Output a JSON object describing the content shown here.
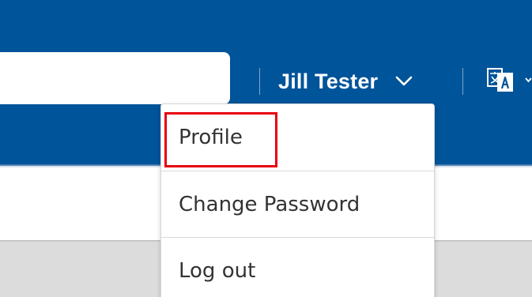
{
  "header": {
    "search": {
      "value": "",
      "placeholder": ""
    },
    "user": {
      "name": "Jill Tester",
      "icon": "chevron-down-icon"
    },
    "language": {
      "icon": "translate-icon"
    }
  },
  "user_dropdown": {
    "items": [
      {
        "label": "Profile",
        "highlighted": true
      },
      {
        "label": "Change Password",
        "highlighted": false
      },
      {
        "label": "Log out",
        "highlighted": false
      }
    ]
  },
  "colors": {
    "header_blue": "#00549a",
    "highlight_red": "#e8000b",
    "gray_band": "#dcdcdc",
    "menu_text": "#333333"
  }
}
